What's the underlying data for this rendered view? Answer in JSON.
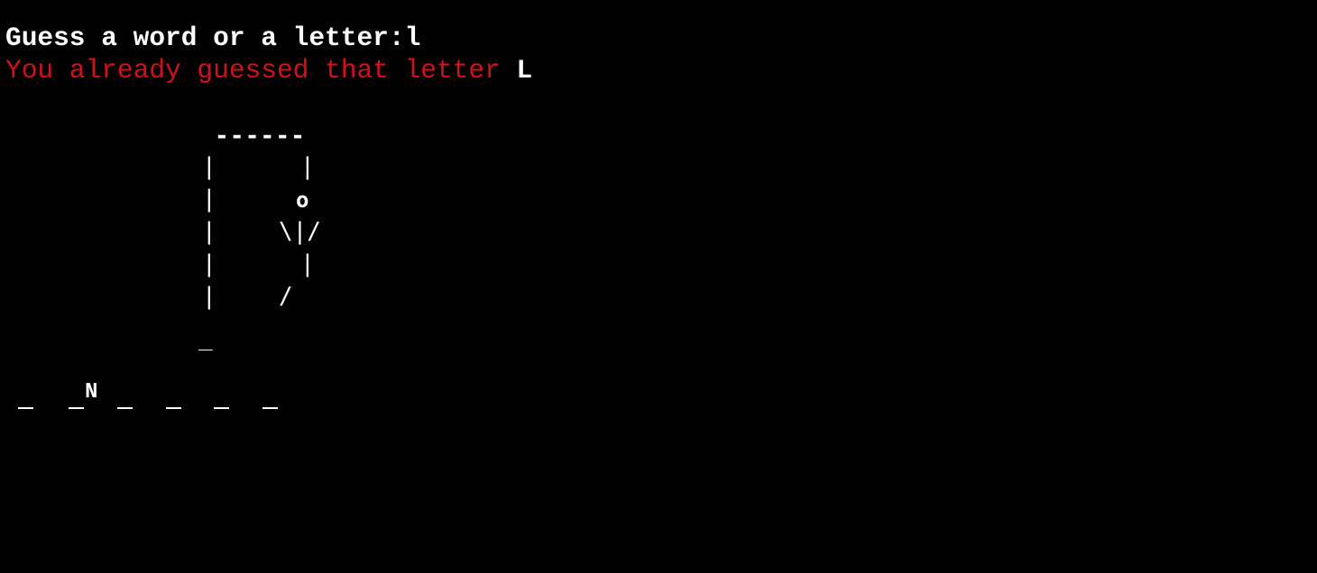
{
  "terminal": {
    "prompt": "Guess a word or a letter:",
    "input": "l",
    "warning": "You already guessed that letter",
    "warning_letter": "L"
  },
  "hangman": {
    "beam": "------",
    "post": "|",
    "rope": "|",
    "head": "o",
    "arms": "\\|/",
    "body": "|",
    "leg": "/",
    "base": "_"
  },
  "word": {
    "slots": [
      "",
      "N",
      "",
      "",
      "",
      ""
    ]
  },
  "colors": {
    "background": "#000000",
    "text": "#ffffff",
    "warning": "#d0121b"
  }
}
